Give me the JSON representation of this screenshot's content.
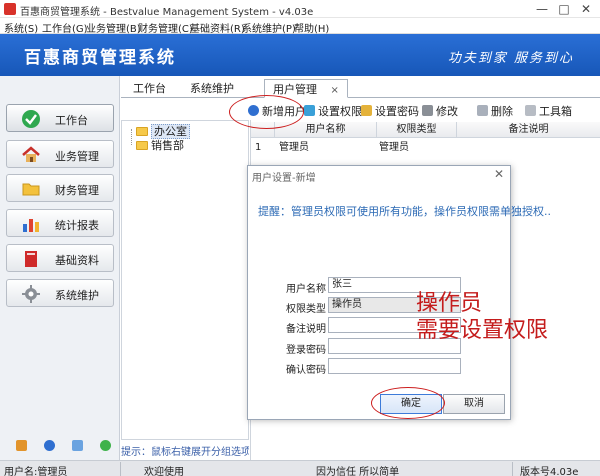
{
  "window": {
    "title": "百惠商贸管理系统 - Bestvalue Management System - v4.03e",
    "minimize": "—",
    "maximize": "□",
    "close": "✕"
  },
  "menu": [
    "系统(S)",
    "工作台(G)",
    "业务管理(B)",
    "财务管理(C)",
    "基础资料(R)",
    "系统维护(P)",
    "帮助(H)"
  ],
  "banner": {
    "brand": "百惠商贸管理系统",
    "slogan": "功夫到家 服务到心"
  },
  "nav": [
    {
      "label": "工作台",
      "icon": "check-circle-icon"
    },
    {
      "label": "业务管理",
      "icon": "house-icon"
    },
    {
      "label": "财务管理",
      "icon": "folder-icon"
    },
    {
      "label": "统计报表",
      "icon": "bar-chart-icon"
    },
    {
      "label": "基础资料",
      "icon": "book-icon"
    },
    {
      "label": "系统维护",
      "icon": "gear-icon"
    }
  ],
  "tabs": [
    {
      "label": "工作台"
    },
    {
      "label": "系统维护"
    },
    {
      "label": "用户管理",
      "close": "×"
    }
  ],
  "toolbar": [
    {
      "label": "新增用户",
      "icon": "plus-icon"
    },
    {
      "label": "设置权限",
      "icon": "key-icon"
    },
    {
      "label": "设置密码",
      "icon": "lock-icon"
    },
    {
      "label": "修改",
      "icon": "edit-icon"
    },
    {
      "label": "删除",
      "icon": "trash-icon"
    },
    {
      "label": "工具箱",
      "icon": "toolbox-icon"
    }
  ],
  "tree": [
    {
      "label": "办公室",
      "selected": true
    },
    {
      "label": "销售部",
      "selected": false
    }
  ],
  "tree_tip": "提示：鼠标右键展开分组选项",
  "grid": {
    "columns": [
      "用户名称",
      "权限类型",
      "备注说明"
    ],
    "rows": [
      {
        "index": "1",
        "name": "管理员",
        "role": "管理员",
        "note": ""
      }
    ]
  },
  "dialog": {
    "title": "用户设置-新增",
    "close": "✕",
    "hint": "提醒：管理员权限可使用所有功能，操作员权限需单独授权..",
    "fields": [
      {
        "label": "用户名称",
        "value": "张三"
      },
      {
        "label": "权限类型",
        "value": "操作员"
      },
      {
        "label": "备注说明",
        "value": ""
      },
      {
        "label": "登录密码",
        "value": ""
      },
      {
        "label": "确认密码",
        "value": ""
      }
    ],
    "ok": "确定",
    "cancel": "取消"
  },
  "annotation": {
    "line1": "操作员",
    "line2": "需要设置权限",
    "color": "#c41c1c"
  },
  "status": {
    "user": "用户名:管理员",
    "welcome": "欢迎使用",
    "motto": "因为信任 所以简单",
    "version": "版本号4.03e"
  },
  "colors": {
    "banner": "#1e63c8",
    "accent": "#2c6ab5",
    "annotation": "#cc1e1e"
  }
}
